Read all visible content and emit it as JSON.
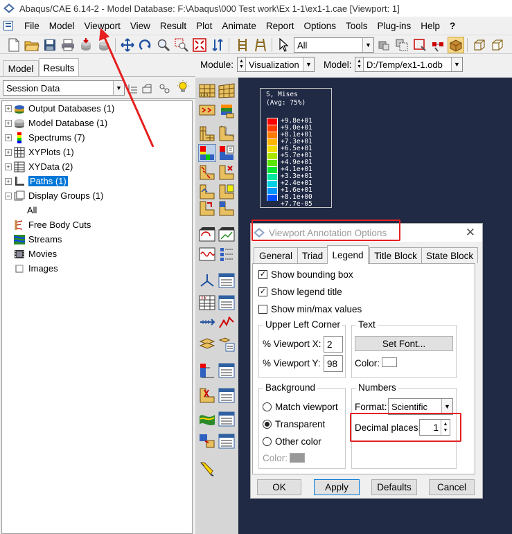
{
  "window": {
    "title": "Abaqus/CAE 6.14-2 - Model Database: F:\\Abaqus\\000 Test work\\Ex 1-1\\ex1-1.cae [Viewport: 1]"
  },
  "menubar": {
    "items": [
      "File",
      "Model",
      "Viewport",
      "View",
      "Result",
      "Plot",
      "Animate",
      "Report",
      "Options",
      "Tools",
      "Plug-ins",
      "Help",
      "?"
    ]
  },
  "toolbar": {
    "selection_filter": "All"
  },
  "context_bar": {
    "module_label": "Module:",
    "module_value": "Visualization",
    "model_label": "Model:",
    "model_value": "D:/Temp/ex1-1.odb"
  },
  "left_panel": {
    "tabs": [
      "Model",
      "Results"
    ],
    "active_tab": "Results",
    "session_combo": "Session Data",
    "tree": [
      {
        "label": "Output Databases (1)",
        "expandable": true
      },
      {
        "label": "Model Database (1)",
        "expandable": true
      },
      {
        "label": "Spectrums (7)",
        "expandable": true
      },
      {
        "label": "XYPlots (1)",
        "expandable": true
      },
      {
        "label": "XYData (2)",
        "expandable": true
      },
      {
        "label": "Paths (1)",
        "expandable": true,
        "selected": true
      },
      {
        "label": "Display Groups (1)",
        "expandable": true,
        "expanded": true
      },
      {
        "label": "All",
        "expandable": false
      },
      {
        "label": "Free Body Cuts",
        "expandable": false
      },
      {
        "label": "Streams",
        "expandable": false
      },
      {
        "label": "Movies",
        "expandable": false
      },
      {
        "label": "Images",
        "expandable": false
      }
    ]
  },
  "legend": {
    "title_line1": "S, Mises",
    "title_line2": "(Avg: 75%)",
    "entries": [
      {
        "value": "+9.8e+01",
        "color": "#ff0000"
      },
      {
        "value": "+9.0e+01",
        "color": "#ff3c00"
      },
      {
        "value": "+8.1e+01",
        "color": "#ff7a00"
      },
      {
        "value": "+7.3e+01",
        "color": "#ffb400"
      },
      {
        "value": "+6.5e+01",
        "color": "#f0dc00"
      },
      {
        "value": "+5.7e+01",
        "color": "#a8e600"
      },
      {
        "value": "+4.9e+01",
        "color": "#5ae600"
      },
      {
        "value": "+4.1e+01",
        "color": "#00e632"
      },
      {
        "value": "+3.3e+01",
        "color": "#00e6a0"
      },
      {
        "value": "+2.4e+01",
        "color": "#00d2e6"
      },
      {
        "value": "+1.6e+01",
        "color": "#0096ff"
      },
      {
        "value": "+8.1e+00",
        "color": "#0050ff"
      },
      {
        "value": "+7.7e-05",
        "color": "#0000ff"
      }
    ]
  },
  "dialog": {
    "title": "Viewport Annotation Options",
    "tabs": [
      "General",
      "Triad",
      "Legend",
      "Title Block",
      "State Block"
    ],
    "active_tab": "Legend",
    "show_bounding_box": {
      "label": "Show bounding box",
      "checked": true
    },
    "show_legend_title": {
      "label": "Show legend title",
      "checked": true
    },
    "show_min_max": {
      "label": "Show min/max values",
      "checked": false
    },
    "upper_left_corner": {
      "title": "Upper Left Corner",
      "x_label": "% Viewport X:",
      "x_value": "2",
      "y_label": "% Viewport Y:",
      "y_value": "98"
    },
    "text": {
      "title": "Text",
      "set_font": "Set Font...",
      "color_label": "Color:"
    },
    "background": {
      "title": "Background",
      "options": [
        "Match viewport",
        "Transparent",
        "Other color"
      ],
      "selected": "Transparent",
      "color_label": "Color:"
    },
    "numbers": {
      "title": "Numbers",
      "format_label": "Format:",
      "format_value": "Scientific",
      "decimal_label": "Decimal places:",
      "decimal_value": "1"
    },
    "buttons": {
      "ok": "OK",
      "apply": "Apply",
      "defaults": "Defaults",
      "cancel": "Cancel"
    }
  },
  "colors": {
    "viewport_bg": "#202a45",
    "selection_blue": "#0078d7",
    "highlight_red": "#e62020"
  }
}
